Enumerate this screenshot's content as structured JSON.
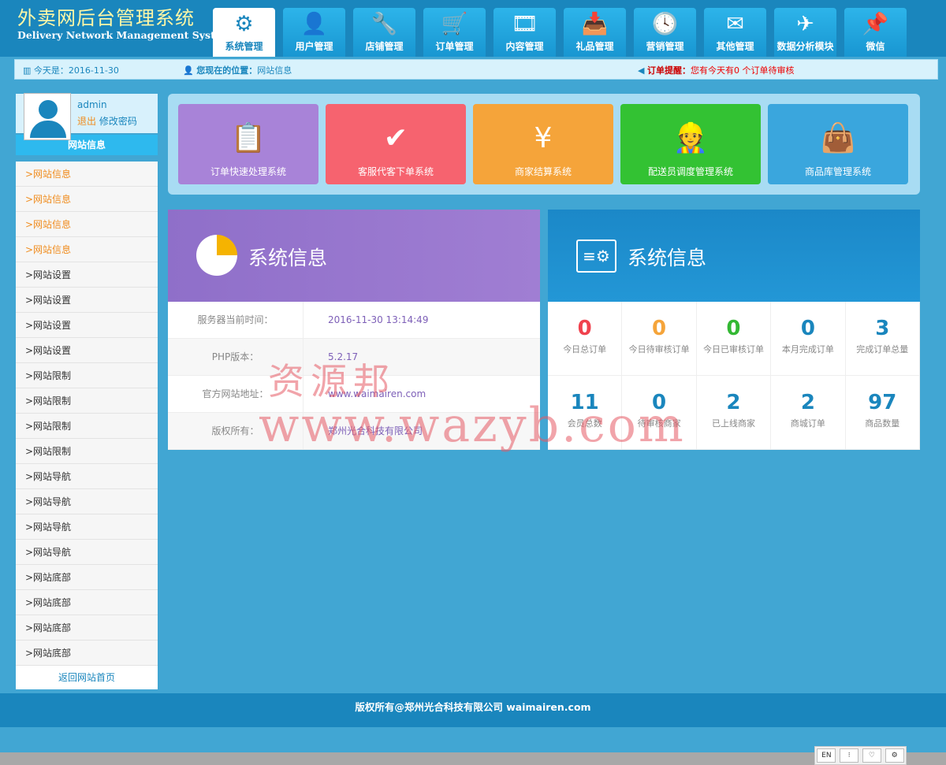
{
  "app": {
    "title_cn": "外卖网后台管理系统",
    "title_en": "Delivery Network Management System"
  },
  "nav": {
    "tabs": [
      {
        "label": "系统管理",
        "icon": "gear-icon",
        "glyph": "⚙",
        "active": true
      },
      {
        "label": "用户管理",
        "icon": "user-icon",
        "glyph": "👤"
      },
      {
        "label": "店铺管理",
        "icon": "tools-icon",
        "glyph": "🔧"
      },
      {
        "label": "订单管理",
        "icon": "cart-icon",
        "glyph": "🛒"
      },
      {
        "label": "内容管理",
        "icon": "film-reel-icon",
        "glyph": "🎞"
      },
      {
        "label": "礼品管理",
        "icon": "gift-box-icon",
        "glyph": "📥"
      },
      {
        "label": "营销管理",
        "icon": "clock-icon",
        "glyph": "🕓"
      },
      {
        "label": "其他管理",
        "icon": "mail-icon",
        "glyph": "✉"
      },
      {
        "label": "数据分析模块",
        "icon": "airplane-icon",
        "glyph": "✈"
      },
      {
        "label": "微信",
        "icon": "pin-icon",
        "glyph": "📌"
      }
    ]
  },
  "infobar": {
    "date_label": "今天是：",
    "date_value": "2016-11-30",
    "location_label": "您现在的位置：",
    "location_value": "网站信息",
    "alert_label": "订单提醒：",
    "alert_value": "您有今天有0 个订单待审核"
  },
  "user": {
    "name": "admin",
    "logout": "退出",
    "change_password": "修改密码"
  },
  "sidebar": {
    "title": "网站信息",
    "items": [
      {
        "label": ">网站信息",
        "highlight": true
      },
      {
        "label": ">网站信息",
        "highlight": true
      },
      {
        "label": ">网站信息",
        "highlight": true
      },
      {
        "label": ">网站信息",
        "highlight": true
      },
      {
        "label": ">网站设置"
      },
      {
        "label": ">网站设置"
      },
      {
        "label": ">网站设置"
      },
      {
        "label": ">网站设置"
      },
      {
        "label": ">网站限制"
      },
      {
        "label": ">网站限制"
      },
      {
        "label": ">网站限制"
      },
      {
        "label": ">网站限制"
      },
      {
        "label": ">网站导航"
      },
      {
        "label": ">网站导航"
      },
      {
        "label": ">网站导航"
      },
      {
        "label": ">网站导航"
      },
      {
        "label": ">网站底部"
      },
      {
        "label": ">网站底部"
      },
      {
        "label": ">网站底部"
      },
      {
        "label": ">网站底部"
      }
    ],
    "back_home": "返回网站首页"
  },
  "quick_tiles": [
    {
      "label": "订单快速处理系统",
      "icon": "notepad-icon",
      "glyph": "📋",
      "color": "#a883d8"
    },
    {
      "label": "客服代客下单系统",
      "icon": "receipt-check-icon",
      "glyph": "✔",
      "color": "#f6636f"
    },
    {
      "label": "商家结算系统",
      "icon": "yuan-notebook-icon",
      "glyph": "¥",
      "color": "#f5a43a"
    },
    {
      "label": "配送员调度管理系统",
      "icon": "courier-icon",
      "glyph": "👷",
      "color": "#33c233"
    },
    {
      "label": "商品库管理系统",
      "icon": "shopping-bag-icon",
      "glyph": "👜",
      "color": "#3aa6dd"
    }
  ],
  "system_info": {
    "title": "系统信息",
    "rows": [
      {
        "label": "服务器当前时间：",
        "value": "2016-11-30 13:14:49"
      },
      {
        "label": "PHP版本：",
        "value": "5.2.17"
      },
      {
        "label": "官方网站地址：",
        "value": "www.waimairen.com"
      },
      {
        "label": "版权所有：",
        "value": "郑州光合科技有限公司"
      }
    ]
  },
  "stats_panel": {
    "title": "系统信息",
    "stats": [
      {
        "value": "0",
        "label": "今日总订单",
        "color": "#f0424e"
      },
      {
        "value": "0",
        "label": "今日待审核订单",
        "color": "#f5a43a"
      },
      {
        "value": "0",
        "label": "今日已审核订单",
        "color": "#33b833"
      },
      {
        "value": "0",
        "label": "本月完成订单",
        "color": "#1a86bd"
      },
      {
        "value": "3",
        "label": "完成订单总量",
        "color": "#1a86bd"
      },
      {
        "value": "11",
        "label": "会员总数",
        "color": "#1a86bd"
      },
      {
        "value": "0",
        "label": "待审核商家",
        "color": "#1a86bd"
      },
      {
        "value": "2",
        "label": "已上线商家",
        "color": "#1a86bd"
      },
      {
        "value": "2",
        "label": "商城订单",
        "color": "#1a86bd"
      },
      {
        "value": "97",
        "label": "商品数量",
        "color": "#1a86bd"
      }
    ]
  },
  "watermark": {
    "line1": "资源邦",
    "line2": "www.wazyb.com"
  },
  "footer": {
    "text": "版权所有@郑州光合科技有限公司 waimairen.com"
  },
  "corner_tools": [
    {
      "label": "EN",
      "icon": "language-icon"
    },
    {
      "label": "⁝",
      "icon": "dots-icon"
    },
    {
      "label": "♡",
      "icon": "heart-icon"
    },
    {
      "label": "⚙",
      "icon": "settings-icon"
    }
  ]
}
